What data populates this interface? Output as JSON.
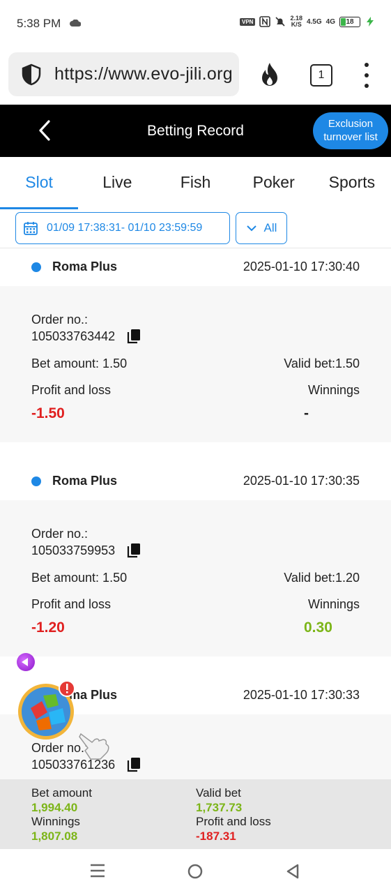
{
  "status_bar": {
    "time": "5:38 PM",
    "vpn": "VPN",
    "speed_value": "2.18",
    "speed_unit": "K/S",
    "net1": "4.5G",
    "net2": "4G",
    "battery": "18"
  },
  "browser": {
    "url": "https://www.evo-jili.org",
    "tab_count": "1"
  },
  "header": {
    "title": "Betting Record",
    "exclusion_line1": "Exclusion",
    "exclusion_line2": "turnover list"
  },
  "tabs": [
    {
      "label": "Slot",
      "active": true
    },
    {
      "label": "Live"
    },
    {
      "label": "Fish"
    },
    {
      "label": "Poker"
    },
    {
      "label": "Sports"
    }
  ],
  "filter": {
    "date_range": "01/09 17:38:31- 01/10 23:59:59",
    "type": "All"
  },
  "records": [
    {
      "game": "Roma Plus",
      "time": "2025-01-10 17:30:40",
      "order_label": "Order no.:",
      "order_no": "105033763442",
      "bet_amount": "Bet amount: 1.50",
      "valid_bet": "Valid bet:1.50",
      "pl_label": "Profit and loss",
      "pl_value": "-1.50",
      "win_label": "Winnings",
      "win_value": "-"
    },
    {
      "game": "Roma Plus",
      "time": "2025-01-10 17:30:35",
      "order_label": "Order no.:",
      "order_no": "105033759953",
      "bet_amount": "Bet amount: 1.50",
      "valid_bet": "Valid bet:1.20",
      "pl_label": "Profit and loss",
      "pl_value": "-1.20",
      "win_label": "Winnings",
      "win_value": "0.30"
    },
    {
      "game": "Roma Plus",
      "time": "2025-01-10 17:30:33",
      "order_label": "Order no.:",
      "order_no": "105033761236"
    }
  ],
  "summary": {
    "bet_amount_label": "Bet amount",
    "bet_amount": "1,994.40",
    "valid_bet_label": "Valid bet",
    "valid_bet": "1,737.73",
    "winnings_label": "Winnings",
    "winnings": "1,807.08",
    "pl_label": "Profit and loss",
    "pl": "-187.31"
  },
  "colors": {
    "accent": "#1e88e5",
    "loss": "#e02020",
    "win": "#7cb518",
    "header_bg": "#000000"
  },
  "icons": [
    "cloud-icon",
    "shield-icon",
    "fire-icon",
    "back-arrow-icon",
    "calendar-icon",
    "chevron-down-icon",
    "copy-icon",
    "menu-icon",
    "home-icon",
    "back-icon"
  ]
}
